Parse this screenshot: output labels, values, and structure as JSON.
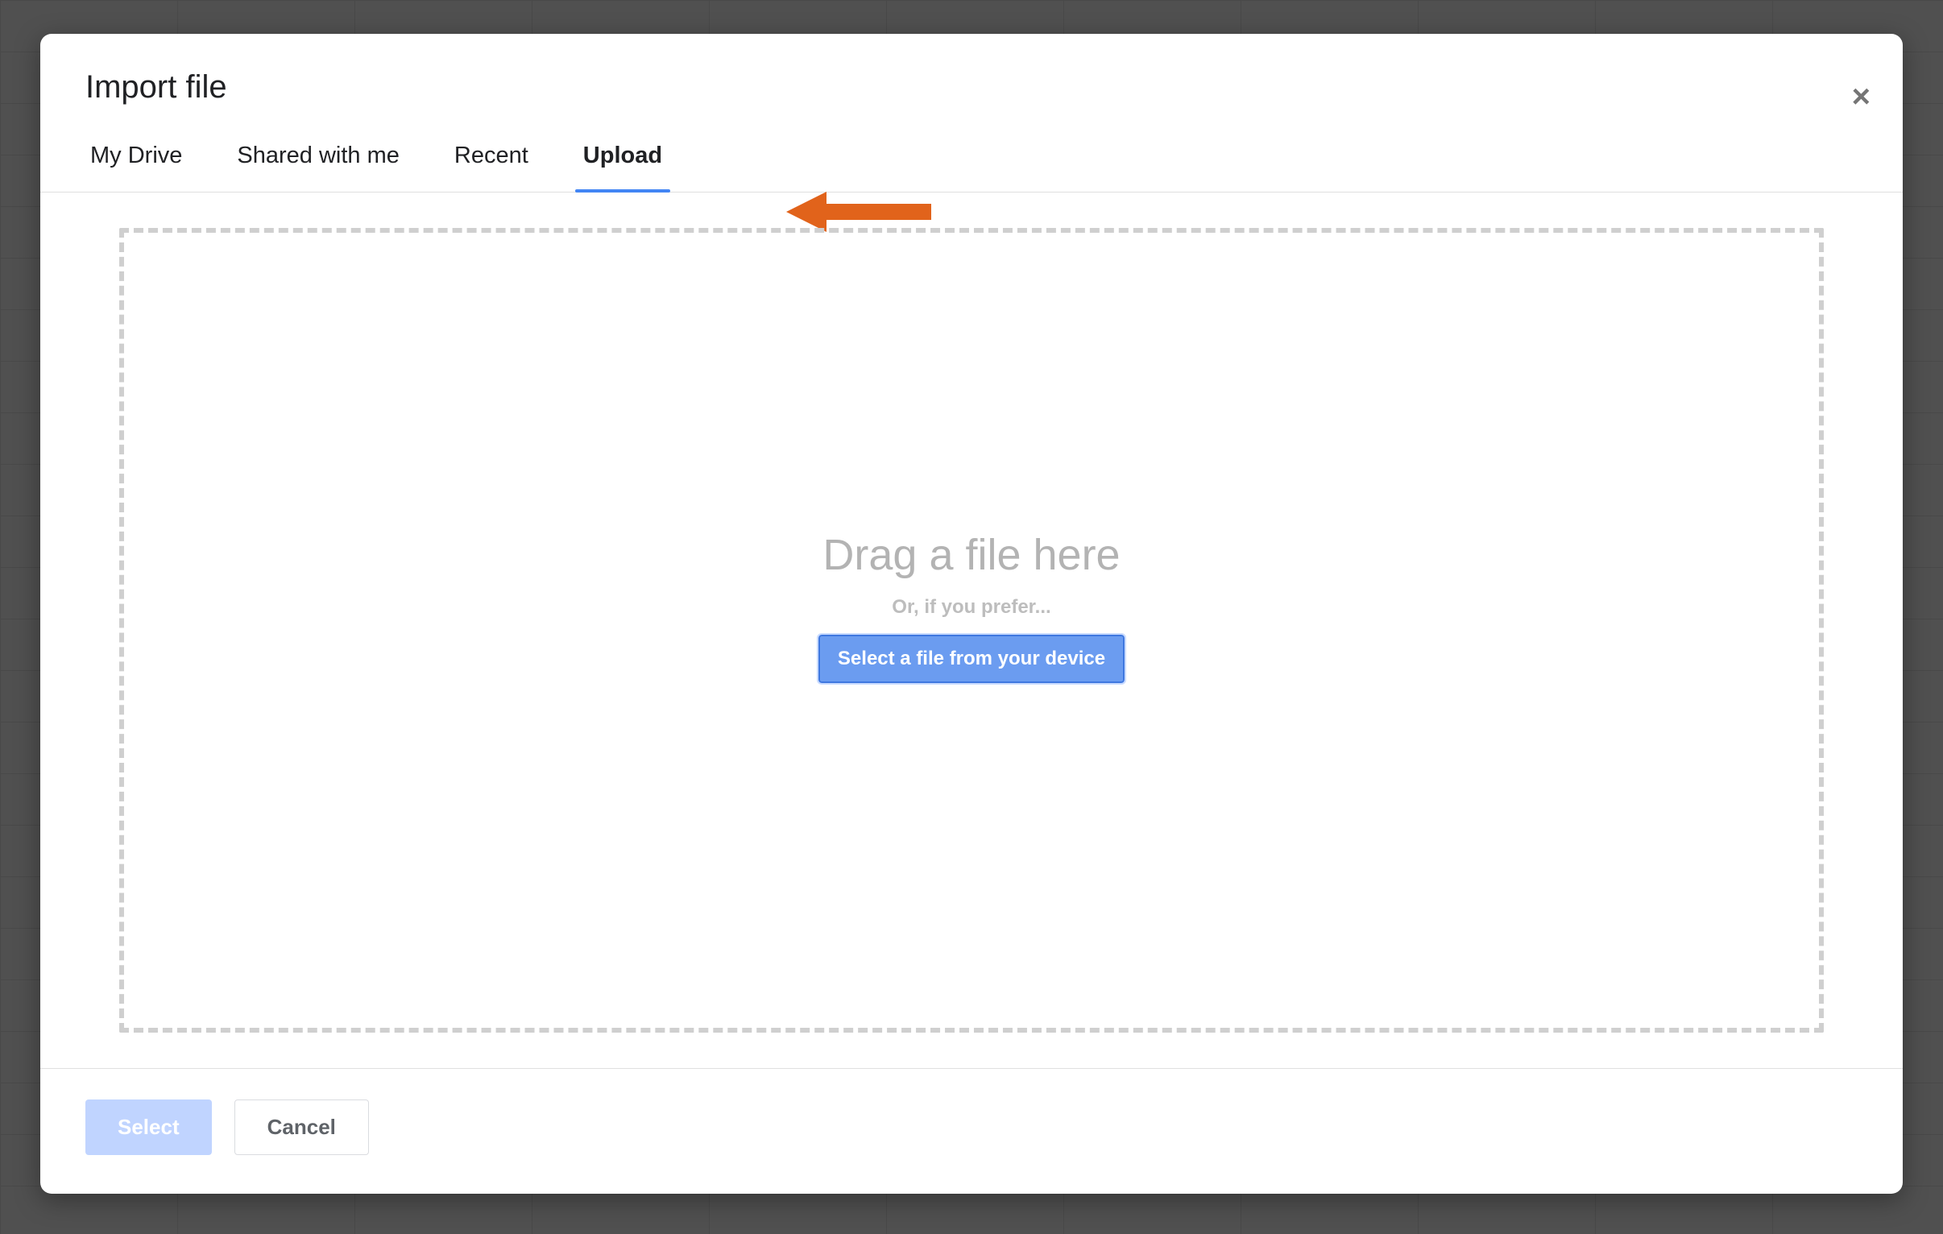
{
  "dialog": {
    "title": "Import file",
    "close_label": "×"
  },
  "tabs": {
    "items": [
      {
        "label": "My Drive",
        "active": false
      },
      {
        "label": "Shared with me",
        "active": false
      },
      {
        "label": "Recent",
        "active": false
      },
      {
        "label": "Upload",
        "active": true
      }
    ]
  },
  "dropzone": {
    "title": "Drag a file here",
    "subtitle": "Or, if you prefer...",
    "button_label": "Select a file from your device"
  },
  "footer": {
    "select_label": "Select",
    "cancel_label": "Cancel"
  },
  "annotation": {
    "arrow_points_to": "Upload tab",
    "color": "#e1631b"
  }
}
